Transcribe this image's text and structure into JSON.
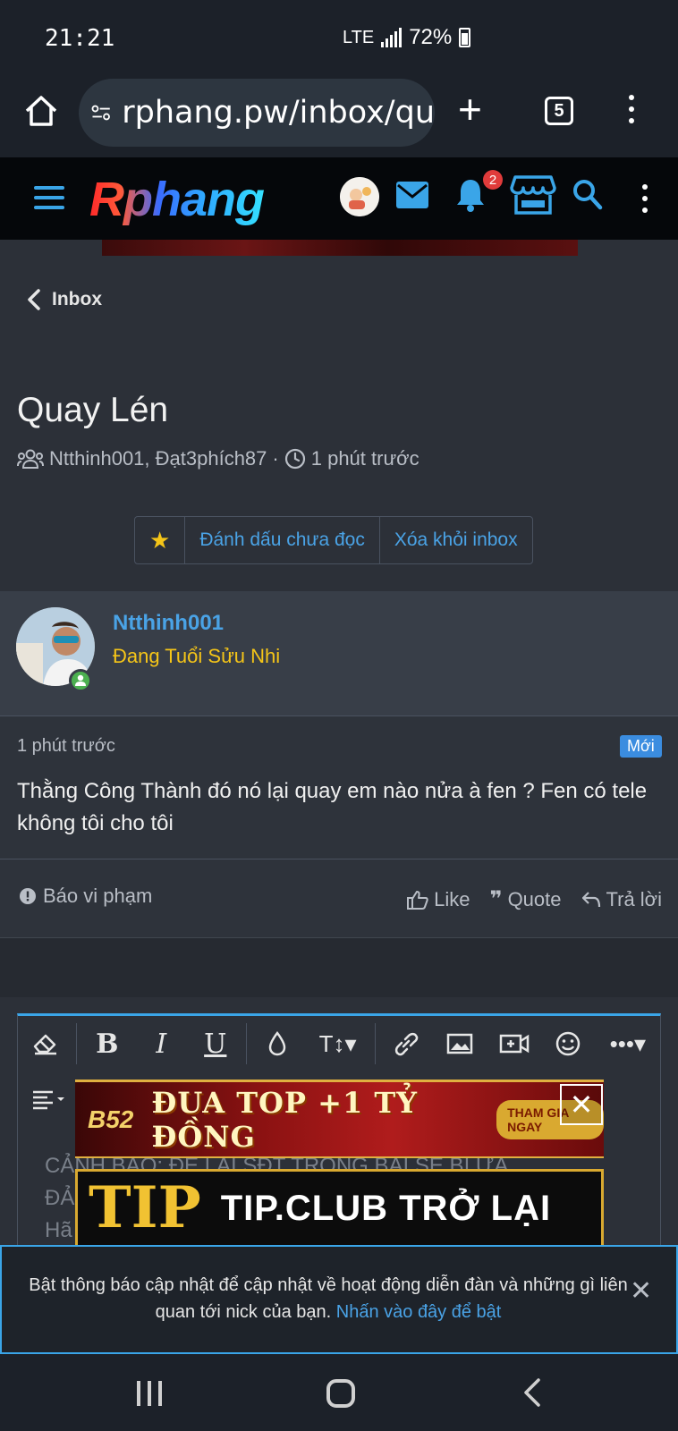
{
  "status_bar": {
    "time": "21:21",
    "network": "LTE",
    "battery": "72%"
  },
  "browser": {
    "url": "rphang.pw/inbox/qu",
    "tab_count": "5"
  },
  "site_nav": {
    "logo": "Rphang",
    "notification_count": "2"
  },
  "breadcrumb": {
    "label": "Inbox"
  },
  "thread": {
    "title": "Quay Lén",
    "participants": "Ntthinh001, Đạt3phích87",
    "separator": "·",
    "time": "1 phút trước"
  },
  "actions": {
    "mark_unread": "Đánh dấu chưa đọc",
    "remove_inbox": "Xóa khỏi inbox"
  },
  "message": {
    "username": "Ntthinh001",
    "user_title": "Đang Tuổi Sửu Nhi",
    "time": "1 phút trước",
    "badge": "Mới",
    "text": "Thằng Công Thành đó nó lại quay em nào nửa à fen ? Fen có tele không tôi cho tôi",
    "report": "Báo vi phạm",
    "like": "Like",
    "quote": "Quote",
    "reply": "Trả lời"
  },
  "editor": {
    "placeholder_line1": "CẢNH BÁO: ĐỂ LẠI SĐT TRONG BÀI SẼ BỊ ỨA",
    "placeholder_line2": "ĐẢ",
    "placeholder_line3": "Hã"
  },
  "ads": {
    "ad1_logo": "B52",
    "ad1_text": "ĐUA TOP +1 TỶ ĐỒNG",
    "ad1_cta": "THAM GIA NGAY",
    "ad2_logo": "TIP",
    "ad2_text": "TIP.CLUB TRỞ LẠI"
  },
  "notification": {
    "text": "Bật thông báo cập nhật để cập nhật về hoạt động diễn đàn và những gì liên quan tới nick của bạn.",
    "link": "Nhấn vào đây để bật"
  },
  "colors": {
    "accent": "#4aa3e6",
    "gold": "#f5c518",
    "background": "#2c3038",
    "online": "#4cb050",
    "badge_red": "#e03b3b"
  }
}
